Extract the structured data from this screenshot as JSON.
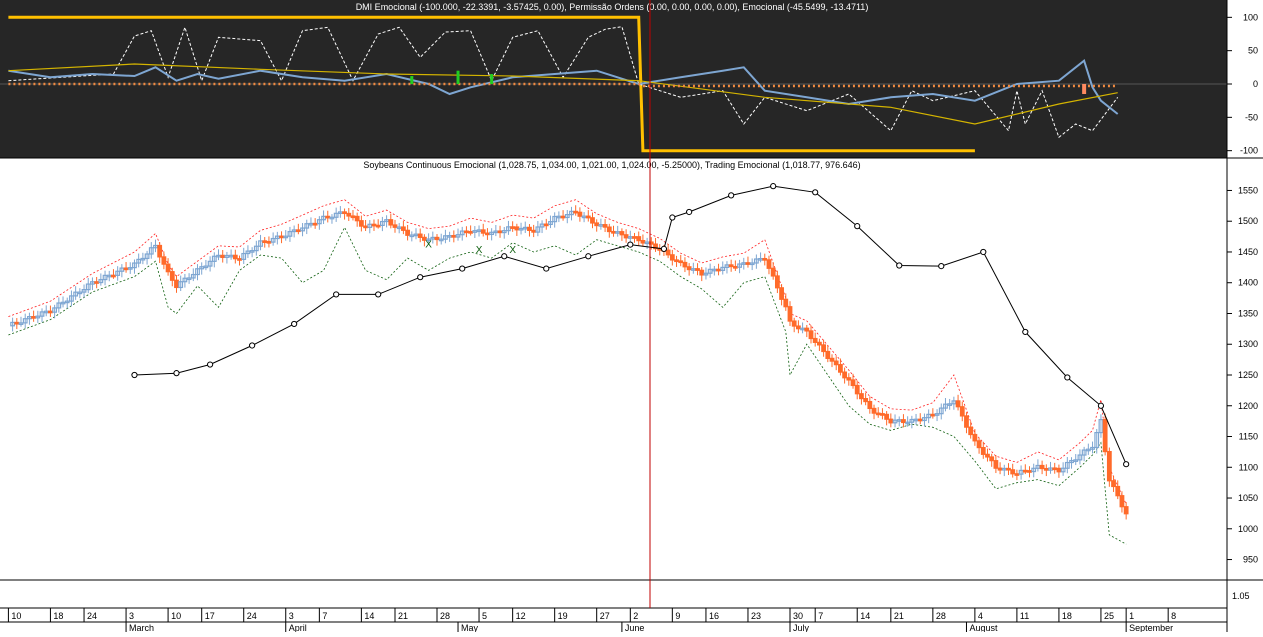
{
  "chart_data": [
    {
      "type": "line",
      "title": "DMI Emocional (-100.000, -22.3391, -3.57425, 0.00), Permissão Ordens (0.00, 0.00, 0.00, 0.00), Emocional (-45.5499, -13.4711)",
      "ylim": [
        -105,
        108
      ],
      "ytick_labels": [
        "100",
        "50",
        "0",
        "-50",
        "-100"
      ],
      "ytick_values": [
        100,
        50,
        0,
        -50,
        -100
      ],
      "colors": {
        "background": "#262626",
        "permissao": "#ffc000",
        "emocional_white": "#ffffff",
        "emocional_blue": "#7ea6d2",
        "yellow_line": "#d4b400",
        "orange_dots": "#f08a40",
        "green_bars": "#22cc22"
      },
      "series": [
        {
          "key": "permissao",
          "x": [
            0,
            150,
            151,
            230
          ],
          "values": [
            100,
            100,
            -100,
            -100
          ]
        },
        {
          "key": "emocional_white",
          "x": [
            0,
            25,
            30,
            34,
            38,
            42,
            46,
            50,
            60,
            65,
            70,
            76,
            82,
            88,
            93,
            98,
            104,
            110,
            115,
            120,
            126,
            132,
            138,
            142,
            146,
            150,
            160,
            170,
            175,
            180,
            190,
            200,
            210,
            215,
            220,
            230,
            238,
            240,
            242,
            246,
            250,
            254,
            258,
            264
          ],
          "values": [
            5,
            15,
            72,
            80,
            10,
            85,
            5,
            70,
            65,
            5,
            80,
            85,
            5,
            75,
            85,
            40,
            78,
            80,
            5,
            70,
            80,
            10,
            70,
            82,
            86,
            0,
            -20,
            -10,
            -60,
            -20,
            -40,
            -15,
            -70,
            -10,
            -25,
            -10,
            -70,
            -10,
            -60,
            -10,
            -80,
            -60,
            -70,
            -20
          ]
        },
        {
          "key": "emocional_blue",
          "x": [
            0,
            10,
            20,
            30,
            35,
            40,
            45,
            50,
            60,
            70,
            80,
            90,
            100,
            105,
            110,
            120,
            130,
            140,
            150,
            160,
            170,
            175,
            180,
            190,
            200,
            210,
            220,
            230,
            240,
            250,
            256,
            258,
            260,
            264
          ],
          "values": [
            20,
            10,
            15,
            12,
            25,
            5,
            15,
            8,
            20,
            10,
            5,
            15,
            0,
            -15,
            -5,
            10,
            15,
            20,
            0,
            10,
            20,
            25,
            -10,
            -20,
            -30,
            -20,
            -15,
            -25,
            0,
            5,
            35,
            -5,
            -25,
            -45
          ]
        },
        {
          "key": "yellow_line",
          "x": [
            0,
            30,
            60,
            90,
            120,
            150,
            180,
            210,
            230,
            250,
            264
          ],
          "values": [
            20,
            30,
            22,
            15,
            12,
            5,
            -20,
            -35,
            -60,
            -30,
            -13
          ]
        },
        {
          "key": "orange_dots",
          "x": [
            0,
            150,
            151,
            264
          ],
          "values": [
            0,
            0,
            -3,
            -3
          ]
        }
      ],
      "bars": {
        "key": "green_bars",
        "x": [
          96,
          107,
          115
        ],
        "values": [
          12,
          20,
          15
        ]
      },
      "markers": [
        {
          "x": 256,
          "value": -15
        }
      ]
    },
    {
      "type": "line",
      "title": "Soybeans Continuous Emocional (1,028.75, 1,034.00, 1,021.00, 1,024.00, -5.25000), Trading Emocional (1,018.77, 976.646)",
      "ylim": [
        920,
        1580
      ],
      "ytick_labels": [
        "1550",
        "1500",
        "1450",
        "1400",
        "1350",
        "1300",
        "1250",
        "1200",
        "1150",
        "1100",
        "1050",
        "1000",
        "950"
      ],
      "ytick_values": [
        1550,
        1500,
        1450,
        1400,
        1350,
        1300,
        1250,
        1200,
        1150,
        1100,
        1050,
        1000,
        950
      ],
      "x_tick_labels": [
        "10",
        "18",
        "24",
        "3",
        "10",
        "17",
        "24",
        "3",
        "7",
        "14",
        "21",
        "28",
        "5",
        "12",
        "19",
        "27",
        "2",
        "9",
        "16",
        "23",
        "30",
        "7",
        "14",
        "21",
        "28",
        "4",
        "11",
        "18",
        "25",
        "1",
        "8"
      ],
      "x_tick_index": [
        0,
        10,
        18,
        28,
        38,
        46,
        56,
        66,
        74,
        84,
        92,
        102,
        112,
        120,
        130,
        140,
        148,
        158,
        166,
        176,
        186,
        192,
        202,
        210,
        220,
        230,
        240,
        250,
        260,
        266,
        276
      ],
      "month_labels": [
        "March",
        "April",
        "May",
        "June",
        "July",
        "August",
        "September"
      ],
      "month_index": [
        28,
        66,
        107,
        146,
        186,
        228,
        266
      ],
      "colors": {
        "up": "#7ea6d2",
        "down": "#ff6a2a",
        "upper": "#ff2020",
        "lower": "#106010",
        "trend": "#000000",
        "vline": "#c00000"
      },
      "series": [
        {
          "key": "close",
          "x": [
            0,
            10,
            20,
            30,
            35,
            38,
            40,
            45,
            50,
            55,
            60,
            65,
            70,
            75,
            80,
            85,
            90,
            95,
            100,
            105,
            110,
            115,
            120,
            125,
            130,
            135,
            140,
            145,
            150,
            155,
            160,
            165,
            170,
            175,
            180,
            185,
            186,
            190,
            195,
            200,
            205,
            210,
            215,
            220,
            225,
            230,
            235,
            240,
            245,
            250,
            255,
            258,
            260,
            262,
            266
          ],
          "values": [
            1330,
            1355,
            1400,
            1430,
            1460,
            1415,
            1395,
            1420,
            1445,
            1440,
            1465,
            1475,
            1490,
            1505,
            1515,
            1490,
            1500,
            1480,
            1470,
            1475,
            1485,
            1480,
            1490,
            1485,
            1505,
            1515,
            1495,
            1480,
            1470,
            1455,
            1430,
            1415,
            1425,
            1430,
            1440,
            1360,
            1335,
            1320,
            1280,
            1240,
            1195,
            1175,
            1175,
            1185,
            1210,
            1140,
            1100,
            1090,
            1100,
            1095,
            1120,
            1135,
            1175,
            1080,
            1025
          ]
        },
        {
          "key": "upper",
          "x": [
            0,
            10,
            20,
            30,
            35,
            38,
            40,
            45,
            50,
            55,
            60,
            65,
            70,
            75,
            80,
            85,
            90,
            95,
            100,
            105,
            110,
            115,
            120,
            125,
            130,
            135,
            140,
            145,
            150,
            155,
            160,
            165,
            170,
            175,
            180,
            185,
            186,
            190,
            195,
            200,
            205,
            210,
            215,
            220,
            225,
            230,
            235,
            240,
            245,
            250,
            255,
            258,
            260,
            262,
            266
          ],
          "values": [
            1345,
            1370,
            1415,
            1450,
            1480,
            1430,
            1410,
            1435,
            1460,
            1458,
            1485,
            1495,
            1510,
            1525,
            1535,
            1508,
            1518,
            1498,
            1488,
            1492,
            1505,
            1498,
            1510,
            1505,
            1525,
            1535,
            1512,
            1498,
            1488,
            1472,
            1448,
            1432,
            1442,
            1448,
            1470,
            1375,
            1350,
            1338,
            1298,
            1258,
            1215,
            1195,
            1193,
            1205,
            1250,
            1155,
            1118,
            1108,
            1125,
            1112,
            1140,
            1160,
            1210,
            1100,
            1040
          ]
        },
        {
          "key": "lower",
          "x": [
            0,
            10,
            20,
            30,
            35,
            38,
            40,
            45,
            50,
            55,
            60,
            65,
            70,
            75,
            80,
            85,
            90,
            95,
            100,
            105,
            110,
            115,
            120,
            125,
            130,
            135,
            140,
            145,
            150,
            155,
            160,
            165,
            170,
            175,
            180,
            185,
            186,
            190,
            195,
            200,
            205,
            210,
            215,
            220,
            225,
            230,
            235,
            240,
            245,
            250,
            255,
            258,
            260,
            262,
            266
          ],
          "values": [
            1315,
            1340,
            1385,
            1410,
            1435,
            1360,
            1350,
            1395,
            1360,
            1420,
            1445,
            1440,
            1400,
            1420,
            1490,
            1420,
            1405,
            1440,
            1420,
            1440,
            1450,
            1440,
            1465,
            1450,
            1460,
            1445,
            1470,
            1460,
            1450,
            1435,
            1410,
            1390,
            1360,
            1400,
            1410,
            1320,
            1250,
            1300,
            1250,
            1200,
            1170,
            1160,
            1170,
            1165,
            1150,
            1110,
            1065,
            1075,
            1080,
            1070,
            1100,
            1120,
            1140,
            990,
            975
          ]
        },
        {
          "key": "trend",
          "x": [
            30,
            40,
            48,
            58,
            68,
            78,
            88,
            98,
            108,
            118,
            128,
            138,
            148,
            156,
            158,
            162,
            172,
            182,
            192,
            202,
            212,
            222,
            232,
            242,
            252,
            260,
            266
          ],
          "values": [
            1250,
            1253,
            1267,
            1298,
            1333,
            1381,
            1381,
            1409,
            1423,
            1443,
            1423,
            1443,
            1462,
            1455,
            1506,
            1515,
            1542,
            1557,
            1547,
            1492,
            1428,
            1427,
            1450,
            1320,
            1246,
            1200,
            1105
          ]
        }
      ],
      "markers": [
        {
          "key": "x-marks",
          "x": [
            100,
            112,
            120
          ],
          "values": [
            1462,
            1453,
            1453
          ]
        }
      ],
      "x_range": [
        -2,
        290
      ]
    }
  ]
}
